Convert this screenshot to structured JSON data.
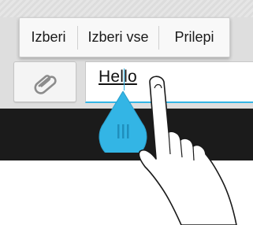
{
  "popup_menu": {
    "items": [
      {
        "label": "Izberi"
      },
      {
        "label": "Izberi vse"
      },
      {
        "label": "Prilepi"
      }
    ]
  },
  "compose": {
    "attach_icon": "paperclip-icon",
    "text_value": "Hello"
  },
  "selection_handle": {
    "icon": "grip-lines-icon",
    "color": "#33b5e5"
  },
  "overlay": {
    "icon": "pointing-hand-icon"
  },
  "colors": {
    "accent": "#33b5e5",
    "compose_bar": "#dedede",
    "keyboard": "#1b1b1b"
  }
}
